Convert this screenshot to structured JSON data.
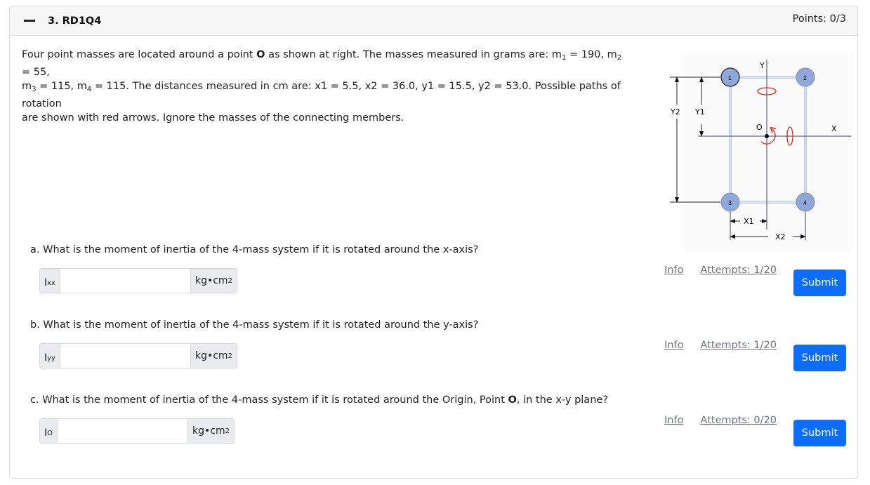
{
  "question": {
    "title": "3. RD1Q4",
    "points": "Points: 0/3",
    "stem": {
      "part1": "Four point masses are located around a point ",
      "point_label": "O",
      "part2": " as shown at right. The masses measured in grams are: m",
      "m1_sub": "1",
      "m1_val": " = 190, m",
      "m2_sub": "2",
      "m2_val": " = 55,",
      "m3_pre": "m",
      "m3_sub": "3",
      "m3_val": " = 115, m",
      "m4_sub": "4",
      "m4_val": " = 115. The distances measured in cm are: x1 = 5.5, x2 = 36.0, y1 = 15.5, y2 = 53.0. Possible paths of rotation",
      "line3": "are shown with red arrows. Ignore the masses of the connecting members."
    }
  },
  "diagram": {
    "labels": {
      "y_axis": "Y",
      "x_axis": "X",
      "origin": "O",
      "y1": "Y1",
      "y2": "Y2",
      "x1": "X1",
      "x2": "X2"
    },
    "masses": [
      "1",
      "2",
      "3",
      "4"
    ],
    "colors": {
      "mass_fill": "#8fa8d8",
      "member": "#b8c8e6",
      "rotation_arrow": "#e8231a"
    }
  },
  "parts": [
    {
      "text": "a. What is the moment of inertia of the 4-mass system if it is rotated around the x-axis?",
      "prefix_main": "I",
      "prefix_sub": "xx",
      "unit_main": "kg•cm",
      "unit_sup": "2",
      "value": "",
      "info": "Info",
      "attempts": "Attempts: 1/20",
      "submit": "Submit"
    },
    {
      "text": "b. What is the moment of inertia of the 4-mass system if it is rotated around the y-axis?",
      "prefix_main": "I",
      "prefix_sub": "yy",
      "unit_main": "kg•cm",
      "unit_sup": "2",
      "value": "",
      "info": "Info",
      "attempts": "Attempts: 1/20",
      "submit": "Submit"
    },
    {
      "text_pre": "c. What is the moment of inertia of the 4-mass system if it is rotated around the Origin, Point ",
      "text_bold": "O",
      "text_post": ", in the x-y plane?",
      "prefix_main": "I",
      "prefix_sub": "O",
      "unit_main": "kg•cm",
      "unit_sup": "2",
      "value": "",
      "info": "Info",
      "attempts": "Attempts: 0/20",
      "submit": "Submit"
    }
  ],
  "colors": {
    "primary": "#0d6efd",
    "header_bg": "#f7f7f7",
    "addon_bg": "#e9ecef",
    "link": "#6c757d"
  }
}
